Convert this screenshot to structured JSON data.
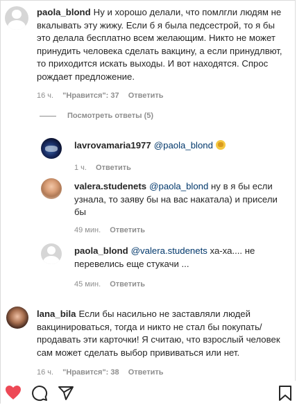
{
  "comments": [
    {
      "user": "paola_blond",
      "lines": [
        "Ну и хорошо делали, что помлгли людям не",
        "вкалывать эту жижу. Если б я была педсестрой, то я бы",
        "это делала бесплатно всем желающим. Никто не может",
        "принудить человека сделать вакцину, а если принудлвют,",
        "то приходится искать выходы. И вот находятся. Спрос",
        "рождает предложение."
      ],
      "time": "16 ч.",
      "likes": "\"Нравится\": 37",
      "reply": "Ответить"
    }
  ],
  "view_replies": "Посмотреть ответы (5)",
  "replies": [
    {
      "user": "lavrovamaria1977",
      "mention": "@paola_blond",
      "time": "1 ч.",
      "reply": "Ответить"
    },
    {
      "user": "valera.studenets",
      "mention": "@paola_blond",
      "text_first": " ну в я бы если",
      "lines": [
        "узнала, то заяву бы на вас накатала) и присели",
        "бы"
      ],
      "time": "49 мин.",
      "reply": "Ответить"
    },
    {
      "user": "paola_blond",
      "mention": "@valera.studenets",
      "text_first": " ха-ха.... не",
      "lines": [
        "перевелись еще стукачи ..."
      ],
      "time": "45 мин.",
      "reply": "Ответить"
    }
  ],
  "second_comment": {
    "user": "lana_bila",
    "first": "Если бы насильно не заставляли людей",
    "lines": [
      "вакцинироваться, тогда и никто не стал бы покупать/",
      "продавать эти карточки! Я считаю, что взрослый человек",
      "сам может сделать выбор прививаться или нет."
    ],
    "time": "16 ч.",
    "likes": "\"Нравится\": 38",
    "reply": "Ответить"
  },
  "colors": {
    "like_heart": "#ed4956",
    "text": "#262626",
    "meta": "#8e8e8e",
    "mention": "#00376b"
  },
  "icons": [
    "heart-icon",
    "comment-icon",
    "share-icon",
    "bookmark-icon"
  ]
}
